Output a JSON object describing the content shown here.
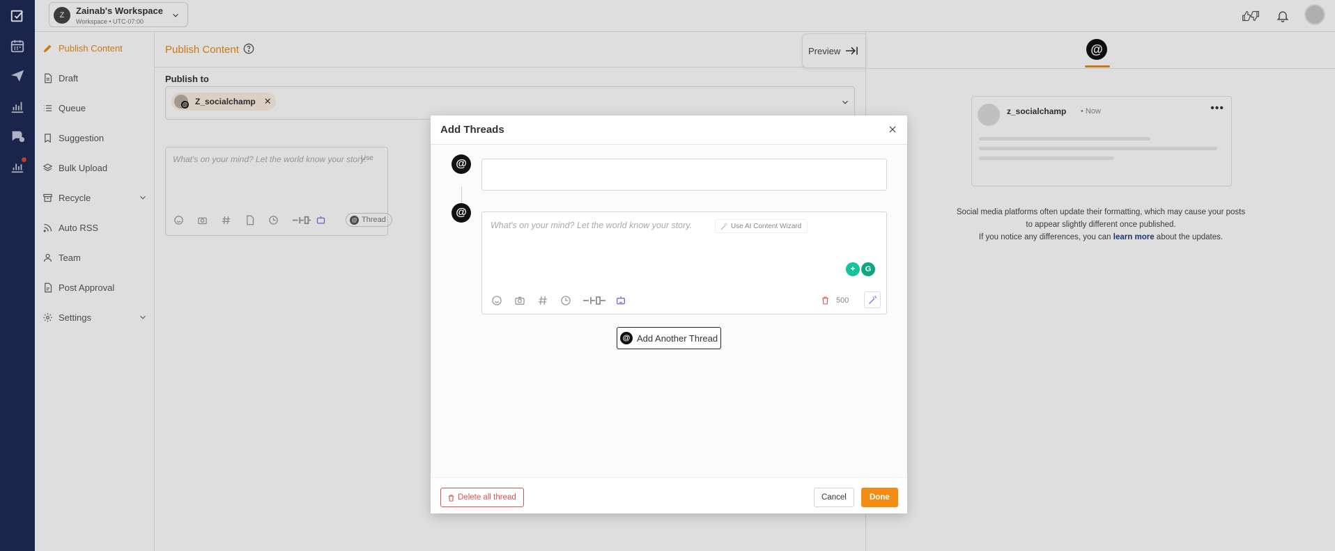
{
  "workspace": {
    "avatar_letter": "Z",
    "name": "Zainab's Workspace",
    "sub": "Workspace • UTC-07:00"
  },
  "sidebar": {
    "items": [
      {
        "label": "Publish Content",
        "icon": "pen-icon",
        "active": true
      },
      {
        "label": "Draft",
        "icon": "file-icon"
      },
      {
        "label": "Queue",
        "icon": "list-icon"
      },
      {
        "label": "Suggestion",
        "icon": "bookmark-icon"
      },
      {
        "label": "Bulk Upload",
        "icon": "layers-icon"
      },
      {
        "label": "Recycle",
        "icon": "archive-icon",
        "expandable": true
      },
      {
        "label": "Auto RSS",
        "icon": "rss-icon"
      },
      {
        "label": "Team",
        "icon": "user-icon"
      },
      {
        "label": "Post Approval",
        "icon": "document-icon"
      },
      {
        "label": "Settings",
        "icon": "gear-icon",
        "expandable": true
      }
    ]
  },
  "main": {
    "title": "Publish Content",
    "publish_to_label": "Publish to",
    "selected_account": "Z_socialchamp",
    "composer_placeholder": "What's on your mind? Let the world know your story.",
    "composer_ai_label": "Use",
    "thread_label": "Thread"
  },
  "preview": {
    "toggle_label": "Preview",
    "username": "z_socialchamp",
    "time": "Now",
    "note_line1": "Social media platforms often update their formatting, which may cause your posts",
    "note_line2": "to appear slightly different once published.",
    "note_line3_pre": "If you notice any differences, you can",
    "note_link": "learn more",
    "note_line3_post": "about the updates."
  },
  "modal": {
    "title": "Add Threads",
    "editor_placeholder": "What's on your mind? Let the world know your story.",
    "ai_wizard_label": "Use AI Content Wizard",
    "char_count": "500",
    "add_thread_label": "Add Another Thread",
    "delete_all_label": "Delete all thread",
    "cancel_label": "Cancel",
    "done_label": "Done"
  },
  "colors": {
    "accent": "#f28c12",
    "rail": "#1f2a56",
    "danger": "#d9534f",
    "link": "#23407a"
  }
}
